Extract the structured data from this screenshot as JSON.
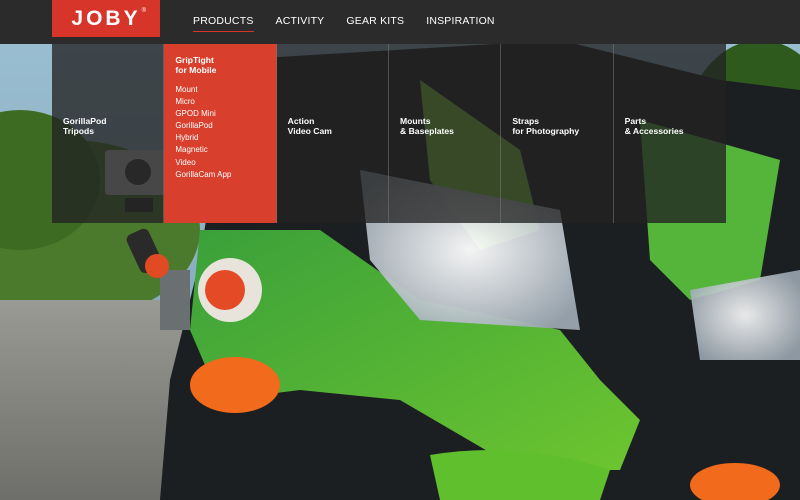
{
  "brand": {
    "logo_text": "JOBY",
    "registered": "®",
    "color": "#d8352a"
  },
  "nav": {
    "items": [
      {
        "label": "PRODUCTS",
        "active": true
      },
      {
        "label": "ACTIVITY",
        "active": false
      },
      {
        "label": "GEAR KITS",
        "active": false
      },
      {
        "label": "INSPIRATION",
        "active": false
      }
    ]
  },
  "menu": {
    "columns": [
      {
        "title": "GorillaPod\nTripods",
        "active": false,
        "items": []
      },
      {
        "title": "GripTight\nfor Mobile",
        "active": true,
        "items": [
          "Mount",
          "Micro",
          "GPOD Mini",
          "GorillaPod",
          "Hybrid",
          "Magnetic",
          "Video",
          "GorillaCam App"
        ]
      },
      {
        "title": "Action\nVideo Cam",
        "active": false,
        "items": []
      },
      {
        "title": "Mounts\n& Baseplates",
        "active": false,
        "items": []
      },
      {
        "title": "Straps\nfor Photography",
        "active": false,
        "items": []
      },
      {
        "title": "Parts\n& Accessories",
        "active": false,
        "items": []
      }
    ]
  },
  "hero": {
    "description_icon": "motorcycle-photo"
  }
}
